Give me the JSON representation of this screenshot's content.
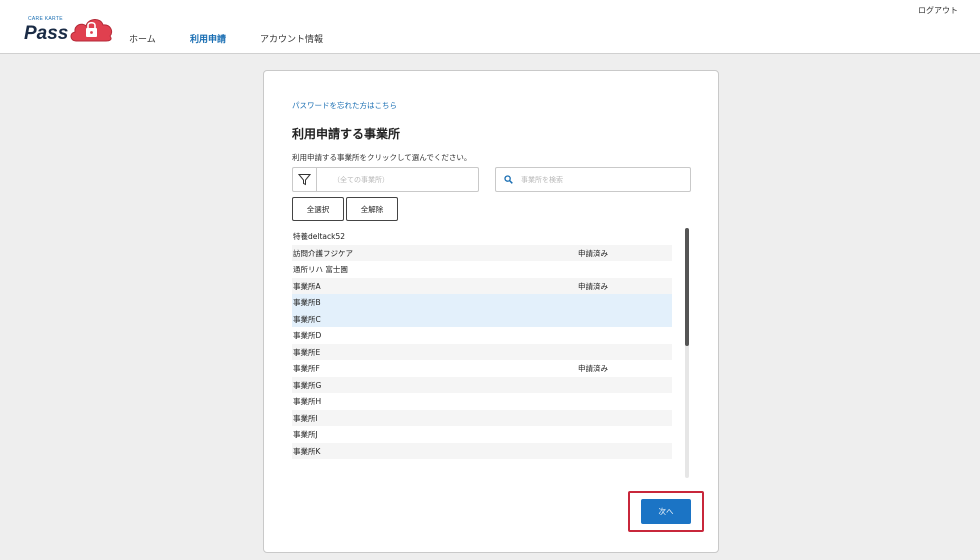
{
  "header": {
    "logo_small": "CARE KARTE",
    "logo_big": "Pass",
    "nav": [
      {
        "label": "ホーム",
        "active": false
      },
      {
        "label": "利用申請",
        "active": true
      },
      {
        "label": "アカウント情報",
        "active": false
      }
    ],
    "logout_label": "ログアウト"
  },
  "card": {
    "forgot_password_link": "パスワードを忘れた方はこちら",
    "title": "利用申請する事業所",
    "description": "利用申請する事業所をクリックして選んでください。",
    "filter": {
      "placeholder": "（全ての事業所）"
    },
    "search": {
      "placeholder": "事業所を検索"
    },
    "select_all_label": "全選択",
    "deselect_all_label": "全解除",
    "offices": [
      {
        "name": "特養deltack52",
        "status": "",
        "selected": false
      },
      {
        "name": "訪問介護フジケア",
        "status": "申請済み",
        "selected": false
      },
      {
        "name": "通所リハ 富士園",
        "status": "",
        "selected": false
      },
      {
        "name": "事業所A",
        "status": "申請済み",
        "selected": false
      },
      {
        "name": "事業所B",
        "status": "",
        "selected": true
      },
      {
        "name": "事業所C",
        "status": "",
        "selected": true
      },
      {
        "name": "事業所D",
        "status": "",
        "selected": false
      },
      {
        "name": "事業所E",
        "status": "",
        "selected": false
      },
      {
        "name": "事業所F",
        "status": "申請済み",
        "selected": false
      },
      {
        "name": "事業所G",
        "status": "",
        "selected": false
      },
      {
        "name": "事業所H",
        "status": "",
        "selected": false
      },
      {
        "name": "事業所I",
        "status": "",
        "selected": false
      },
      {
        "name": "事業所J",
        "status": "",
        "selected": false
      },
      {
        "name": "事業所K",
        "status": "",
        "selected": false
      }
    ],
    "next_label": "次へ"
  },
  "colors": {
    "accent": "#1b74c5",
    "highlight": "#c8273b",
    "selected_row": "#e3f0fb",
    "logo_cloud": "#e0404f"
  },
  "icons": {
    "filter": "filter-icon",
    "search": "search-icon",
    "logo": "cloud-lock-icon"
  }
}
